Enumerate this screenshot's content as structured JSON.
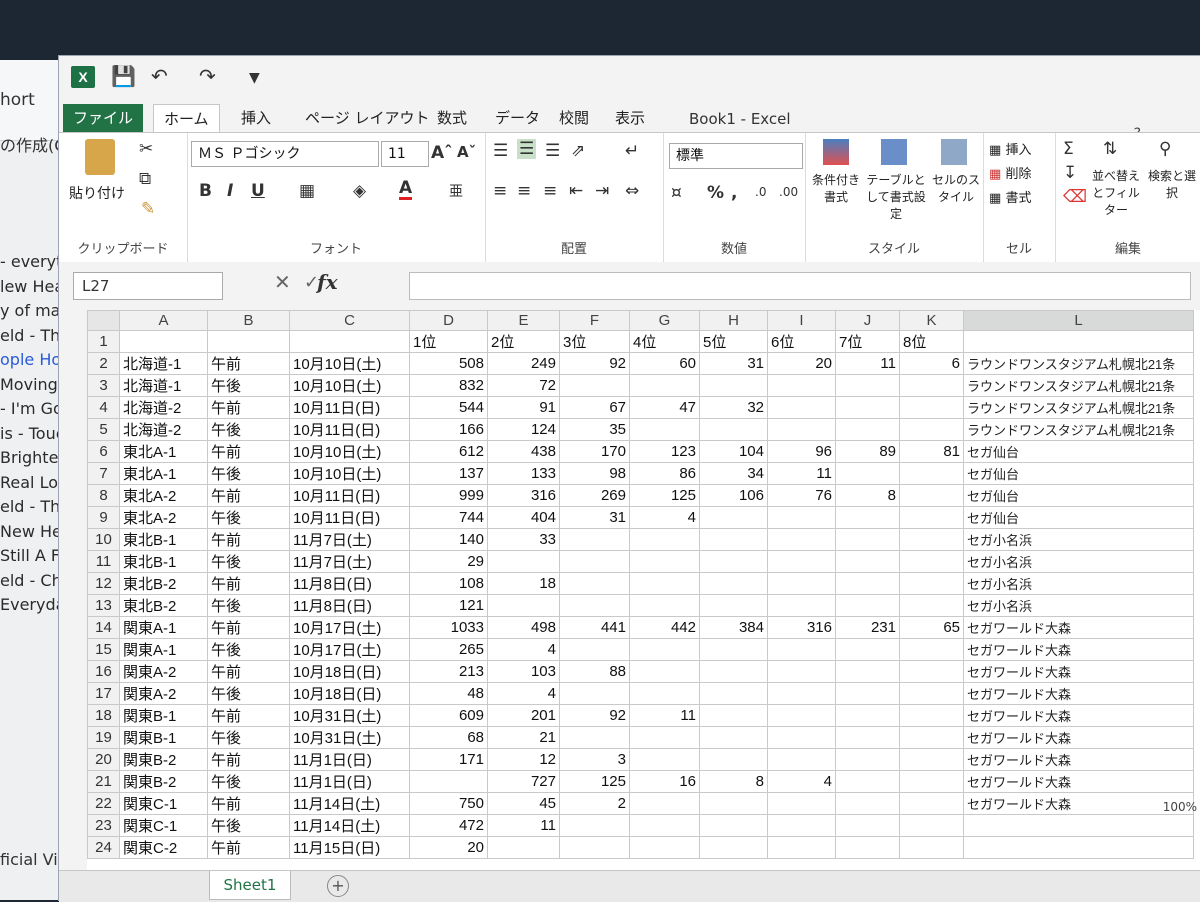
{
  "background_window": {
    "header_text_1": "hort",
    "header_text_2": "の作成(C",
    "items": [
      "- everyt",
      "lew Hea",
      "y of may",
      "eld - Thi",
      "ople Ho",
      "Moving o",
      "- I'm Go",
      "is - Touc",
      "Brighte",
      "Real Lo",
      "eld - The",
      "New Hea",
      "Still A Fr",
      "eld - Cha",
      "Everyday"
    ],
    "bottom_text": "ficial Video"
  },
  "excel": {
    "title": "Book1 - Excel",
    "tabs": [
      "ファイル",
      "ホーム",
      "挿入",
      "ページ レイアウト",
      "数式",
      "データ",
      "校閲",
      "表示"
    ],
    "ribbon": {
      "paste_label": "貼り付け",
      "clipboard_group": "クリップボード",
      "font_name": "ＭＳ Ｐゴシック",
      "font_size": "11",
      "font_group": "フォント",
      "alignment_group": "配置",
      "number_format": "標準",
      "number_group": "数値",
      "cond_format": "条件付き書式",
      "table_format": "テーブルとして書式設定",
      "cell_styles": "セルのスタイル",
      "styles_group": "スタイル",
      "insert": "挿入",
      "delete": "削除",
      "format": "書式",
      "cells_group": "セル",
      "sort_filter": "並べ替えとフィルター",
      "find_select": "検索と選択",
      "edit_group": "編集"
    },
    "name_box": "L27",
    "sheet_tab": "Sheet1",
    "zoom": "100%",
    "columns": [
      "A",
      "B",
      "C",
      "D",
      "E",
      "F",
      "G",
      "H",
      "I",
      "J",
      "K",
      "L"
    ],
    "header_row": [
      "",
      "",
      "",
      "1位",
      "2位",
      "3位",
      "4位",
      "5位",
      "6位",
      "7位",
      "8位",
      ""
    ],
    "rows": [
      [
        "北海道-1",
        "午前",
        "10月10日(土)",
        "508",
        "249",
        "92",
        "60",
        "31",
        "20",
        "11",
        "6",
        "ラウンドワンスタジアム札幌北21条"
      ],
      [
        "北海道-1",
        "午後",
        "10月10日(土)",
        "832",
        "72",
        "",
        "",
        "",
        "",
        "",
        "",
        "ラウンドワンスタジアム札幌北21条"
      ],
      [
        "北海道-2",
        "午前",
        "10月11日(日)",
        "544",
        "91",
        "67",
        "47",
        "32",
        "",
        "",
        "",
        "ラウンドワンスタジアム札幌北21条"
      ],
      [
        "北海道-2",
        "午後",
        "10月11日(日)",
        "166",
        "124",
        "35",
        "",
        "",
        "",
        "",
        "",
        "ラウンドワンスタジアム札幌北21条"
      ],
      [
        "東北A-1",
        "午前",
        "10月10日(土)",
        "612",
        "438",
        "170",
        "123",
        "104",
        "96",
        "89",
        "81",
        "セガ仙台"
      ],
      [
        "東北A-1",
        "午後",
        "10月10日(土)",
        "137",
        "133",
        "98",
        "86",
        "34",
        "11",
        "",
        "",
        "セガ仙台"
      ],
      [
        "東北A-2",
        "午前",
        "10月11日(日)",
        "999",
        "316",
        "269",
        "125",
        "106",
        "76",
        "8",
        "",
        "セガ仙台"
      ],
      [
        "東北A-2",
        "午後",
        "10月11日(日)",
        "744",
        "404",
        "31",
        "4",
        "",
        "",
        "",
        "",
        "セガ仙台"
      ],
      [
        "東北B-1",
        "午前",
        "11月7日(土)",
        "140",
        "33",
        "",
        "",
        "",
        "",
        "",
        "",
        "セガ小名浜"
      ],
      [
        "東北B-1",
        "午後",
        "11月7日(土)",
        "29",
        "",
        "",
        "",
        "",
        "",
        "",
        "",
        "セガ小名浜"
      ],
      [
        "東北B-2",
        "午前",
        "11月8日(日)",
        "108",
        "18",
        "",
        "",
        "",
        "",
        "",
        "",
        "セガ小名浜"
      ],
      [
        "東北B-2",
        "午後",
        "11月8日(日)",
        "121",
        "",
        "",
        "",
        "",
        "",
        "",
        "",
        "セガ小名浜"
      ],
      [
        "関東A-1",
        "午前",
        "10月17日(土)",
        "1033",
        "498",
        "441",
        "442",
        "384",
        "316",
        "231",
        "65",
        "セガワールド大森"
      ],
      [
        "関東A-1",
        "午後",
        "10月17日(土)",
        "265",
        "4",
        "",
        "",
        "",
        "",
        "",
        "",
        "セガワールド大森"
      ],
      [
        "関東A-2",
        "午前",
        "10月18日(日)",
        "213",
        "103",
        "88",
        "",
        "",
        "",
        "",
        "",
        "セガワールド大森"
      ],
      [
        "関東A-2",
        "午後",
        "10月18日(日)",
        "48",
        "4",
        "",
        "",
        "",
        "",
        "",
        "",
        "セガワールド大森"
      ],
      [
        "関東B-1",
        "午前",
        "10月31日(土)",
        "609",
        "201",
        "92",
        "11",
        "",
        "",
        "",
        "",
        "セガワールド大森"
      ],
      [
        "関東B-1",
        "午後",
        "10月31日(土)",
        "68",
        "21",
        "",
        "",
        "",
        "",
        "",
        "",
        "セガワールド大森"
      ],
      [
        "関東B-2",
        "午前",
        "11月1日(日)",
        "171",
        "12",
        "3",
        "",
        "",
        "",
        "",
        "",
        "セガワールド大森"
      ],
      [
        "関東B-2",
        "午後",
        "11月1日(日)",
        "",
        "727",
        "125",
        "16",
        "8",
        "4",
        "",
        "",
        "セガワールド大森"
      ],
      [
        "関東C-1",
        "午前",
        "11月14日(土)",
        "750",
        "45",
        "2",
        "",
        "",
        "",
        "",
        "",
        "セガワールド大森"
      ],
      [
        "関東C-1",
        "午後",
        "11月14日(土)",
        "472",
        "11",
        "",
        "",
        "",
        "",
        "",
        "",
        ""
      ],
      [
        "関東C-2",
        "午前",
        "11月15日(日)",
        "20",
        "",
        "",
        "",
        "",
        "",
        "",
        "",
        ""
      ]
    ]
  }
}
